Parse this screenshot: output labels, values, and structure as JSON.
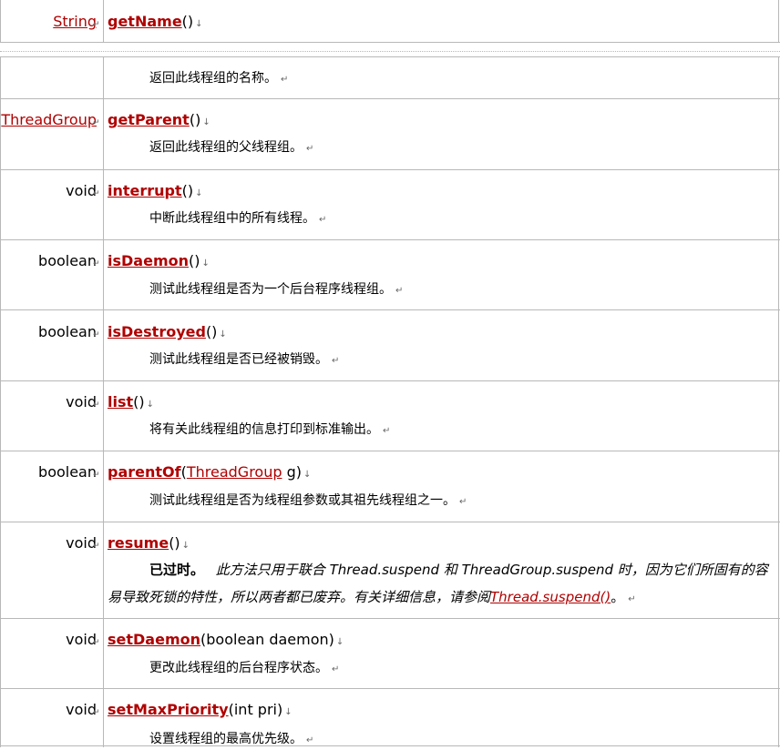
{
  "rows": [
    {
      "type": "String",
      "type_link": true,
      "name": "getName",
      "params": [
        {
          "text": "()"
        }
      ],
      "desc": "返回此线程组的名称。"
    },
    {
      "type": "ThreadGroup",
      "type_link": true,
      "name": "getParent",
      "params": [
        {
          "text": "()"
        }
      ],
      "desc": "返回此线程组的父线程组。"
    },
    {
      "type": "void",
      "type_link": false,
      "name": "interrupt",
      "params": [
        {
          "text": "()"
        }
      ],
      "desc": "中断此线程组中的所有线程。"
    },
    {
      "type": "boolean",
      "type_link": false,
      "name": "isDaemon",
      "params": [
        {
          "text": "()"
        }
      ],
      "desc": "测试此线程组是否为一个后台程序线程组。"
    },
    {
      "type": "boolean",
      "type_link": false,
      "name": "isDestroyed",
      "params": [
        {
          "text": "()"
        }
      ],
      "desc": "测试此线程组是否已经被销毁。"
    },
    {
      "type": "void",
      "type_link": false,
      "name": "list",
      "params": [
        {
          "text": "()"
        }
      ],
      "desc": "将有关此线程组的信息打印到标准输出。"
    },
    {
      "type": "boolean",
      "type_link": false,
      "name": "parentOf",
      "params": [
        {
          "text": "("
        },
        {
          "text": "ThreadGroup",
          "link": true
        },
        {
          "text": " g)"
        }
      ],
      "desc": "测试此线程组是否为线程组参数或其祖先线程组之一。"
    },
    {
      "type": "void",
      "type_link": false,
      "name": "resume",
      "params": [
        {
          "text": "()"
        }
      ],
      "desc": ""
    },
    {
      "type": "void",
      "type_link": false,
      "name": "setDaemon",
      "params": [
        {
          "text": "(boolean daemon)"
        }
      ],
      "desc": "更改此线程组的后台程序状态。"
    },
    {
      "type": "void",
      "type_link": false,
      "name": "setMaxPriority",
      "params": [
        {
          "text": "(int pri)"
        }
      ],
      "desc": "设置线程组的最高优先级。"
    }
  ],
  "deprecated": {
    "label": "已过时。",
    "line1": "此方法只用于联合 Thread.suspend 和 ThreadGroup.suspend 时，因为它们所固有的容",
    "line2": "易导致死锁的特性，所以两者都已废弃。有关详细信息，请参阅",
    "link": "Thread.suspend()",
    "end": "。"
  },
  "marks": {
    "return_mark": "↵",
    "arrow_mark": "↓",
    "cell_mark": "↵"
  }
}
